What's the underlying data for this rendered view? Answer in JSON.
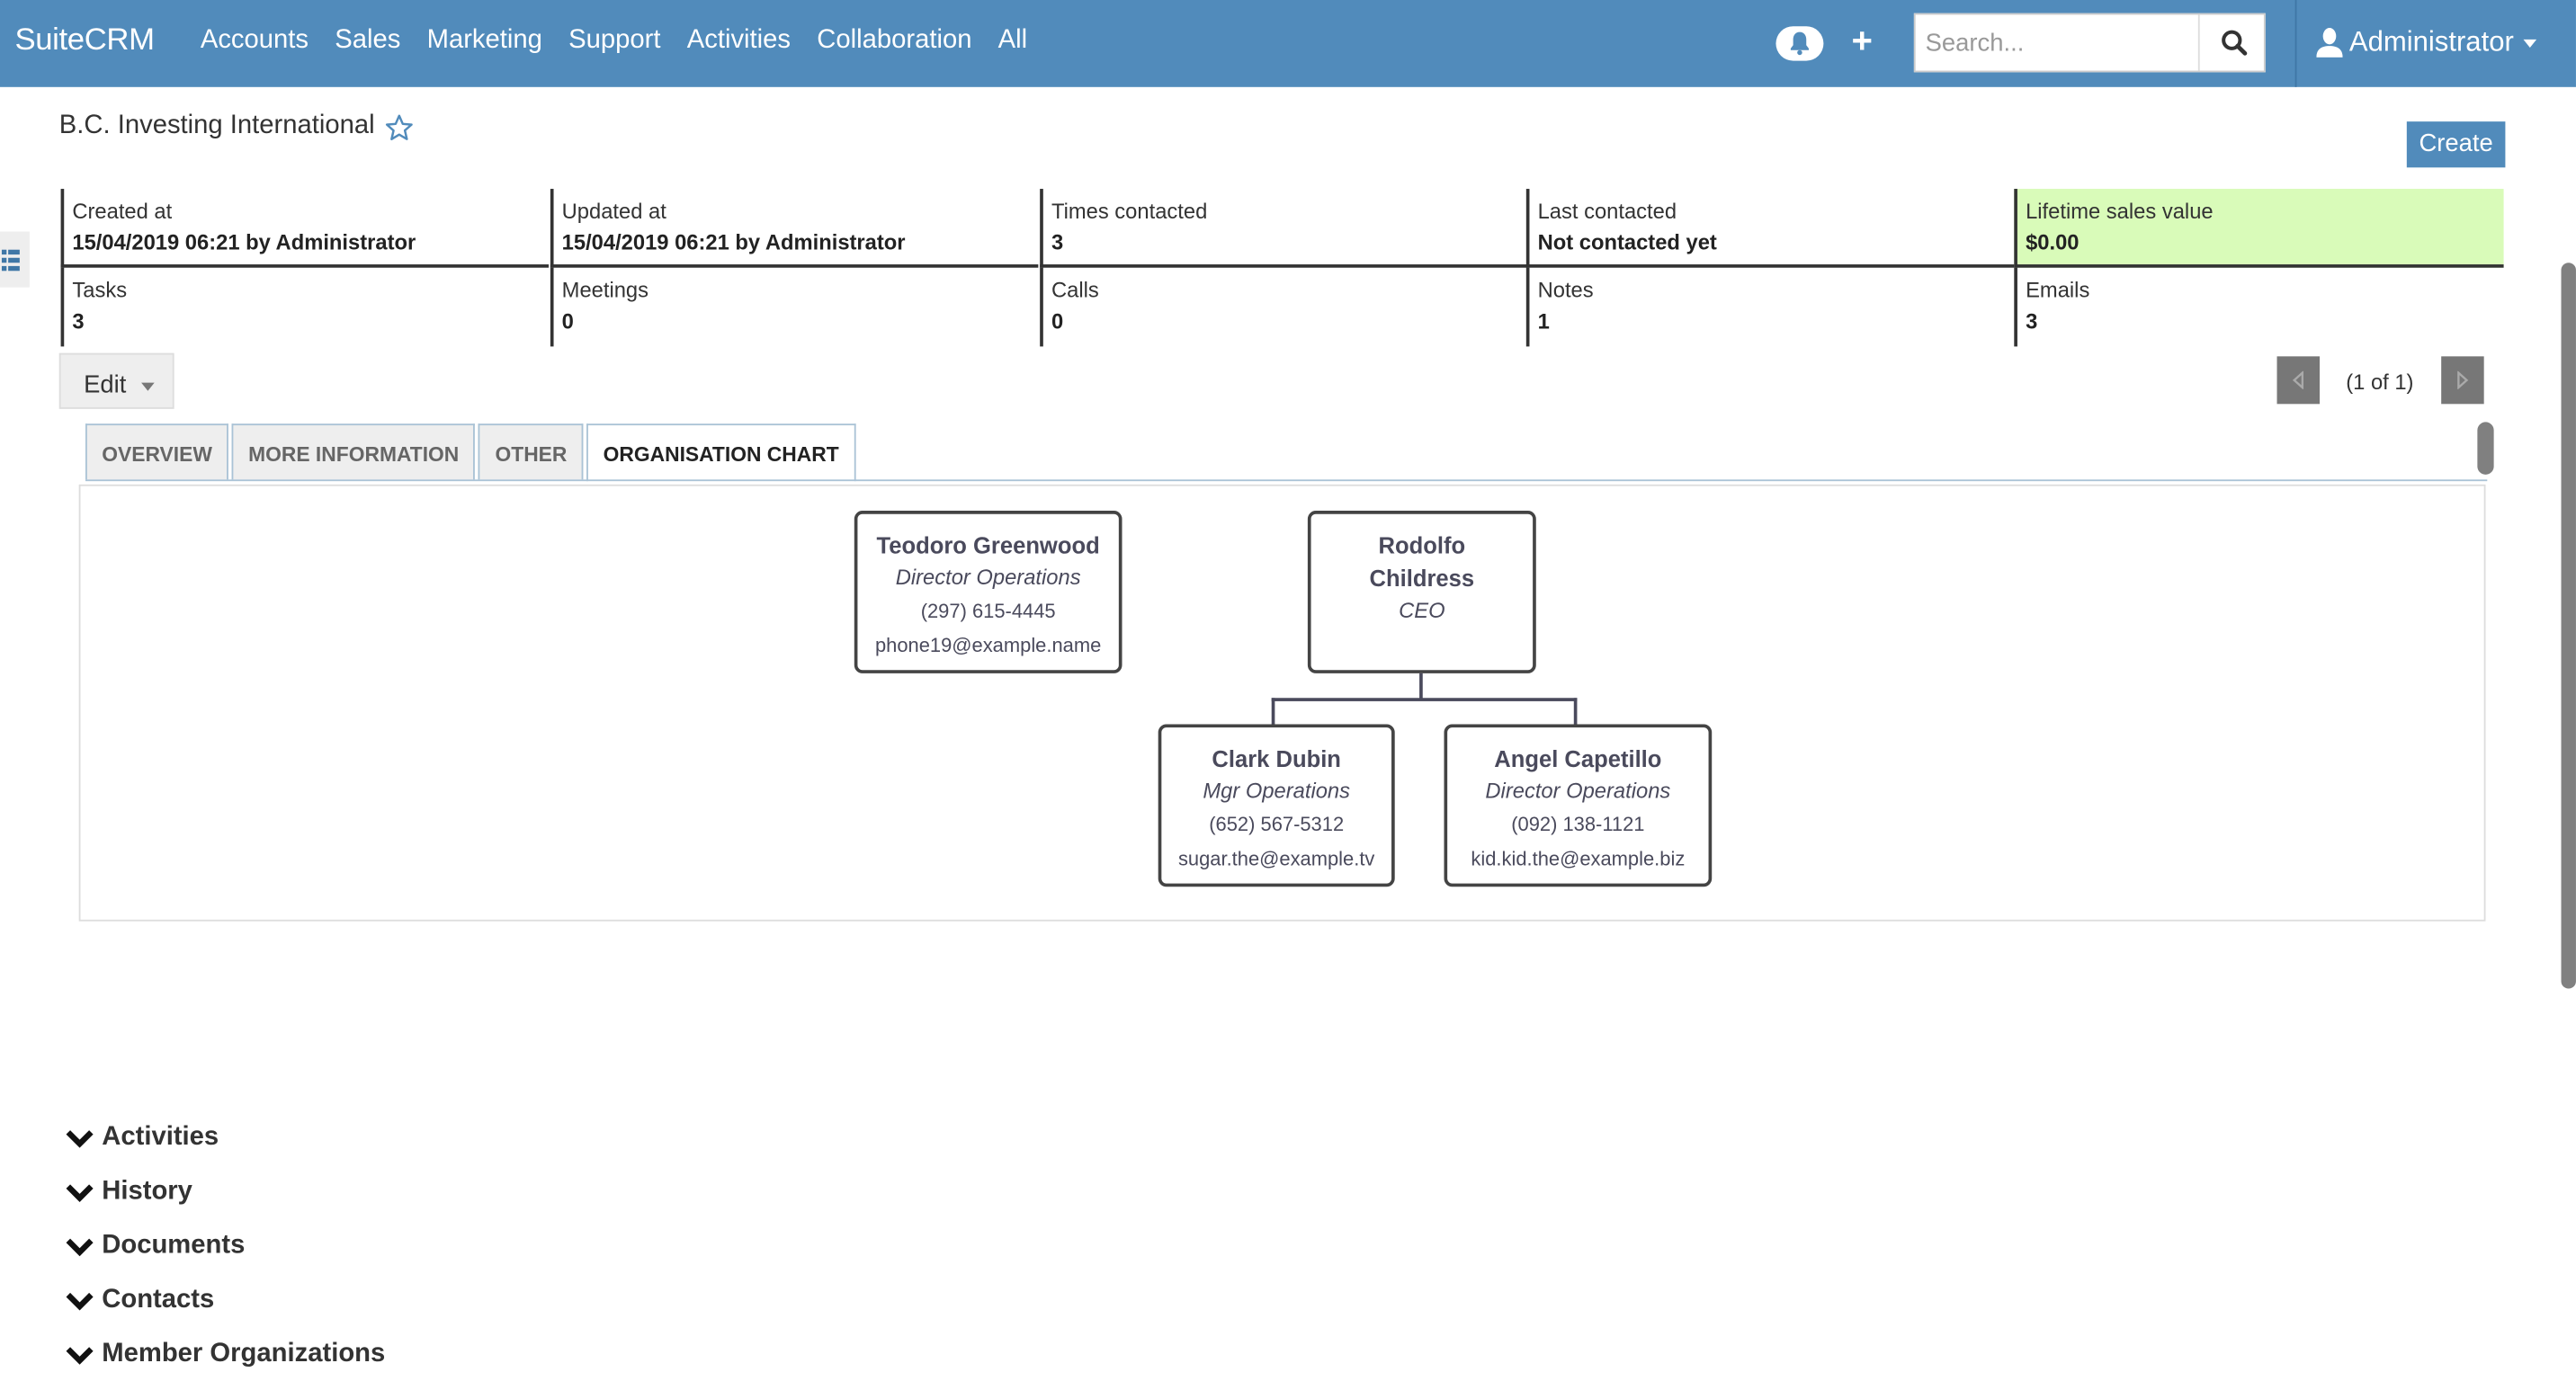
{
  "nav": {
    "brand": "SuiteCRM",
    "links": [
      "Accounts",
      "Sales",
      "Marketing",
      "Support",
      "Activities",
      "Collaboration",
      "All"
    ],
    "search_placeholder": "Search...",
    "user": "Administrator"
  },
  "record": {
    "title": "B.C. Investing International",
    "create_label": "Create",
    "edit_label": "Edit",
    "pager_text": "(1 of 1)"
  },
  "stats": [
    {
      "label": "Created at",
      "value": "15/04/2019 06:21 by Administrator"
    },
    {
      "label": "Updated at",
      "value": "15/04/2019 06:21 by Administrator"
    },
    {
      "label": "Times contacted",
      "value": "3"
    },
    {
      "label": "Last contacted",
      "value": "Not contacted yet"
    },
    {
      "label": "Lifetime sales value",
      "value": "$0.00"
    },
    {
      "label": "Tasks",
      "value": "3"
    },
    {
      "label": "Meetings",
      "value": "0"
    },
    {
      "label": "Calls",
      "value": "0"
    },
    {
      "label": "Notes",
      "value": "1"
    },
    {
      "label": "Emails",
      "value": "3"
    }
  ],
  "tabs": [
    {
      "label": "OVERVIEW",
      "active": false
    },
    {
      "label": "MORE INFORMATION",
      "active": false
    },
    {
      "label": "OTHER",
      "active": false
    },
    {
      "label": "ORGANISATION CHART",
      "active": true
    }
  ],
  "org_chart": {
    "nodes": [
      {
        "name": "Teodoro Greenwood",
        "title": "Director Operations",
        "phone": "(297) 615-4445",
        "email": "phone19@example.name"
      },
      {
        "name_line1": "Rodolfo",
        "name_line2": "Childress",
        "title": "CEO"
      },
      {
        "name": "Clark Dubin",
        "title": "Mgr Operations",
        "phone": "(652) 567-5312",
        "email": "sugar.the@example.tv"
      },
      {
        "name": "Angel Capetillo",
        "title": "Director Operations",
        "phone": "(092) 138-1121",
        "email": "kid.kid.the@example.biz"
      }
    ]
  },
  "subpanels": [
    "Activities",
    "History",
    "Documents",
    "Contacts",
    "Member Organizations"
  ],
  "colors": {
    "nav_bg": "#518bbb",
    "accent": "#518bbb",
    "highlight": "#d9fbb9"
  }
}
